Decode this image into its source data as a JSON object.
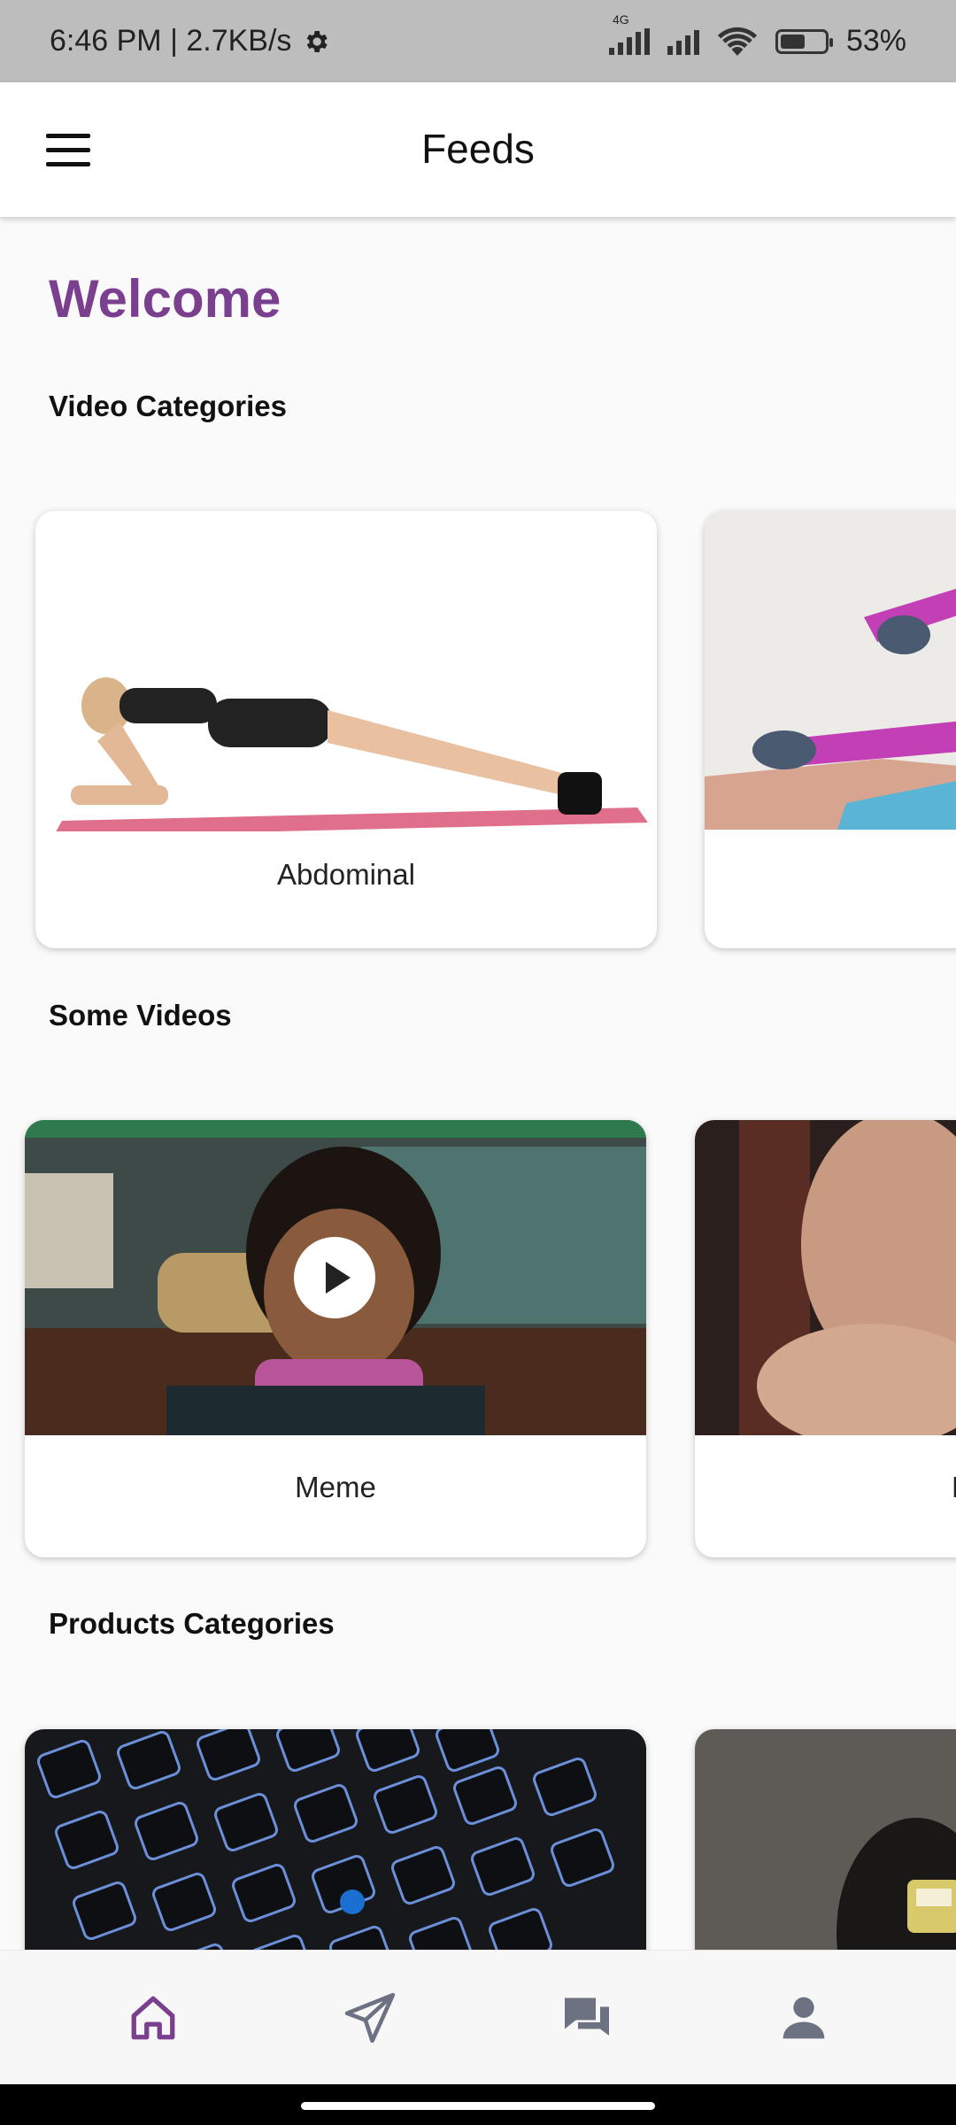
{
  "status_bar": {
    "time_speed": "6:46 PM | 2.7KB/s",
    "network_type": "4G",
    "battery": "53%",
    "icons": [
      "settings-gear-icon",
      "signal-4g-icon",
      "signal-icon",
      "wifi-icon",
      "battery-icon"
    ]
  },
  "app_bar": {
    "title": "Feeds",
    "menu_icon": "hamburger-menu-icon"
  },
  "content": {
    "welcome": "Welcome",
    "sections": {
      "video_categories": {
        "title": "Video Categories",
        "items": [
          {
            "label": "Abdominal",
            "thumbnail": "plank-exercise-image"
          },
          {
            "label": "",
            "thumbnail": "leg-exercise-image"
          }
        ]
      },
      "some_videos": {
        "title": "Some Videos",
        "items": [
          {
            "label": "Meme",
            "thumbnail": "meme-video-thumbnail",
            "play_icon": "play-icon"
          },
          {
            "label": "M",
            "thumbnail": "man-video-thumbnail"
          }
        ]
      },
      "products_categories": {
        "title": "Products Categories",
        "items": [
          {
            "thumbnail": "keyboard-image"
          },
          {
            "thumbnail": "product-image"
          }
        ]
      }
    }
  },
  "bottom_nav": {
    "items": [
      {
        "icon": "home-icon",
        "active": true
      },
      {
        "icon": "send-icon",
        "active": false
      },
      {
        "icon": "chat-icon",
        "active": false
      },
      {
        "icon": "profile-icon",
        "active": false
      }
    ],
    "active_color": "#7b3f8f",
    "inactive_color": "#6d7282"
  },
  "colors": {
    "accent": "#7b3f8f",
    "status_bar": "#bdbdbd"
  }
}
